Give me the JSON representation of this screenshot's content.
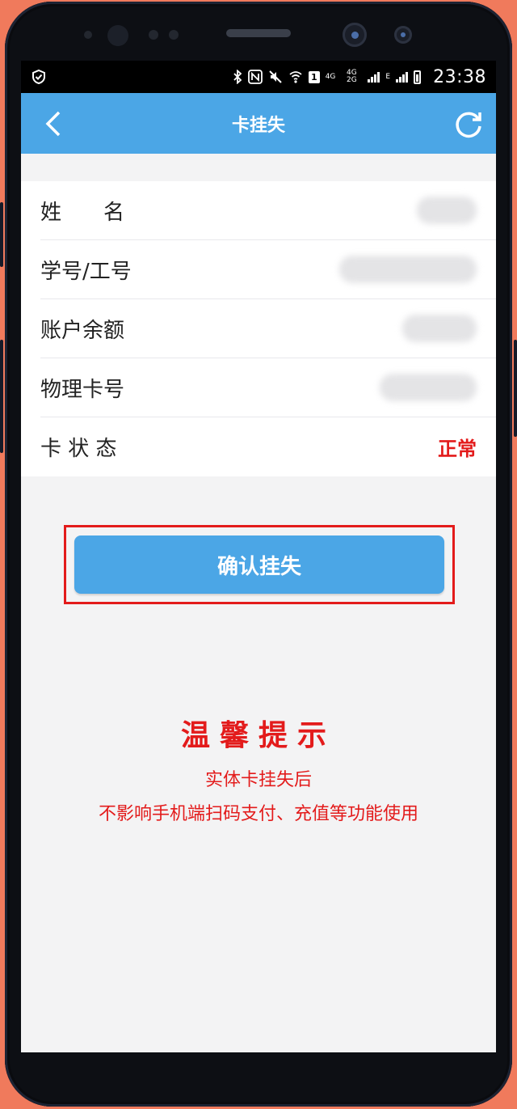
{
  "status_bar": {
    "time": "23:38",
    "sim_badge": "1",
    "network_4g": "4G",
    "network_4g_2g": "4G 2G",
    "network_e": "E"
  },
  "nav": {
    "title": "卡挂失",
    "back_icon": "chevron-left-icon",
    "refresh_icon": "refresh-icon"
  },
  "info": {
    "rows": [
      {
        "label": "姓　　名"
      },
      {
        "label": "学号/工号"
      },
      {
        "label": "账户余额"
      },
      {
        "label": "物理卡号"
      },
      {
        "label": "卡 状 态",
        "value": "正常"
      }
    ]
  },
  "confirm_button": {
    "label": "确认挂失"
  },
  "tips": {
    "title": "温馨提示",
    "line1": "实体卡挂失后",
    "line2": "不影响手机端扫码支付、充值等功能使用"
  },
  "colors": {
    "accent": "#4ba6e6",
    "alert": "#e31b1b",
    "background": "#f3f3f4",
    "frame": "#f07a5c"
  }
}
